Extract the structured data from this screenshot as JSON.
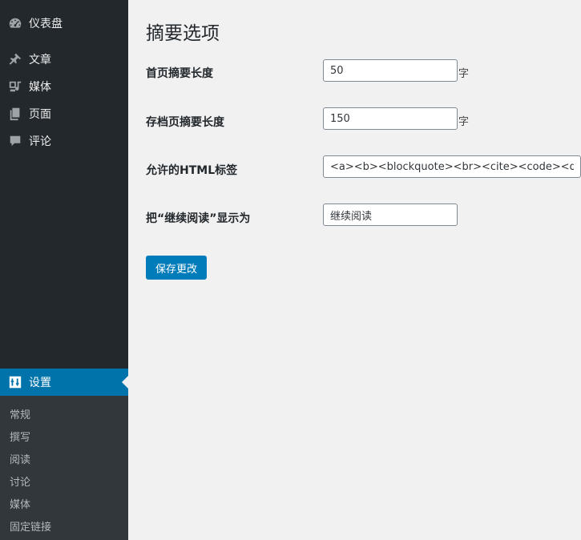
{
  "sidebar": {
    "items": [
      {
        "label": "仪表盘",
        "icon": "dashboard-icon"
      },
      {
        "label": "文章",
        "icon": "pin-icon"
      },
      {
        "label": "媒体",
        "icon": "media-icon"
      },
      {
        "label": "页面",
        "icon": "pages-icon"
      },
      {
        "label": "评论",
        "icon": "comments-icon"
      }
    ],
    "current": {
      "label": "设置",
      "icon": "settings-icon"
    },
    "submenu": [
      "常规",
      "撰写",
      "阅读",
      "讨论",
      "媒体",
      "固定链接"
    ]
  },
  "main": {
    "title": "摘要选项",
    "fields": {
      "home_excerpt": {
        "label": "首页摘要长度",
        "value": "50",
        "suffix": "字"
      },
      "archive_excerpt": {
        "label": "存档页摘要长度",
        "value": "150",
        "suffix": "字"
      },
      "allowed_html": {
        "label": "允许的HTML标签",
        "value": "<a><b><blockquote><br><cite><code><dd><del><div><dl><dt><em><h1><h2><h3><h4><h5><h6><i><img><li><ol><p><pre><span><strong><ul>"
      },
      "read_more": {
        "label": "把“继续阅读”显示为",
        "value": "继续阅读"
      }
    },
    "save_label": "保存更改"
  },
  "colors": {
    "sidebar_bg": "#23282d",
    "accent": "#0073aa",
    "submenu_bg": "#32373c",
    "button": "#007cba"
  }
}
